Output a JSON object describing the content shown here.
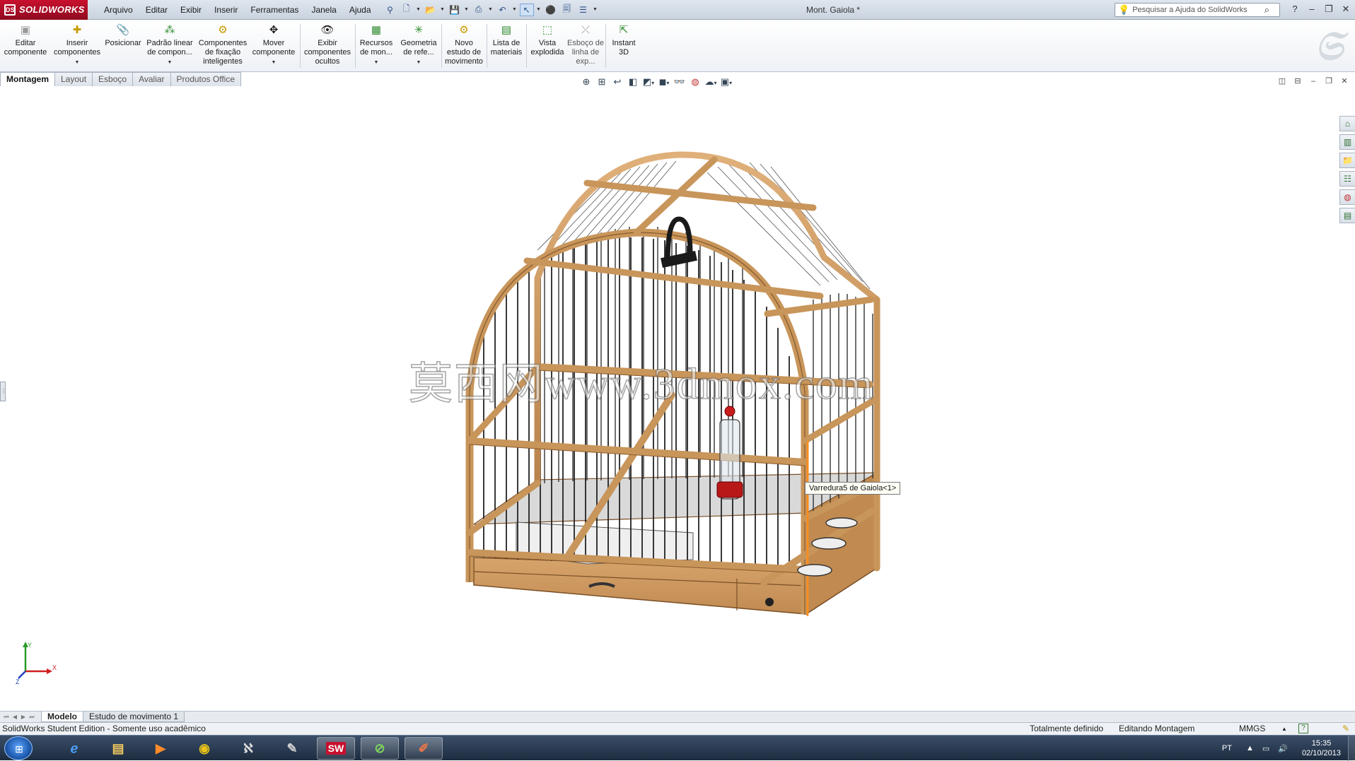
{
  "app": {
    "brand": "SOLIDWORKS",
    "document_title": "Mont. Gaiola *"
  },
  "menu": [
    "Arquivo",
    "Editar",
    "Exibir",
    "Inserir",
    "Ferramentas",
    "Janela",
    "Ajuda"
  ],
  "help_search": {
    "placeholder": "Pesquisar a Ajuda do SolidWorks"
  },
  "command_manager": [
    {
      "label": "Editar componente",
      "icon": "edit-component-icon"
    },
    {
      "label": "Inserir componentes",
      "icon": "insert-components-icon"
    },
    {
      "label": "Posicionar",
      "icon": "mate-icon"
    },
    {
      "label": "Padrão linear de compon...",
      "icon": "linear-pattern-icon"
    },
    {
      "label": "Componentes de fixação inteligentes",
      "icon": "smart-fasteners-icon"
    },
    {
      "label": "Mover componente",
      "icon": "move-component-icon"
    },
    {
      "label": "Exibir componentes ocultos",
      "icon": "show-hidden-icon"
    },
    {
      "label": "Recursos de mon...",
      "icon": "assembly-features-icon"
    },
    {
      "label": "Geometria de refe...",
      "icon": "reference-geometry-icon"
    },
    {
      "label": "Novo estudo de movimento",
      "icon": "motion-study-icon"
    },
    {
      "label": "Lista de materiais",
      "icon": "bom-icon"
    },
    {
      "label": "Vista explodida",
      "icon": "exploded-view-icon"
    },
    {
      "label": "Esboço de linha de exp...",
      "icon": "explode-line-sketch-icon"
    },
    {
      "label": "Instant 3D",
      "icon": "instant3d-icon"
    }
  ],
  "tabs": [
    "Montagem",
    "Layout",
    "Esboço",
    "Avaliar",
    "Produtos Office"
  ],
  "active_tab": "Montagem",
  "viewport": {
    "watermark": "莫西网www.3dmox.com",
    "tooltip": "Varredura5 de Gaiola<1>",
    "triad_labels": {
      "x": "X",
      "y": "Y",
      "z": "Z"
    }
  },
  "bottom_tabs": [
    "Modelo",
    "Estudo de movimento 1"
  ],
  "status": {
    "edition": "SolidWorks Student Edition - Somente uso acadêmico",
    "definition": "Totalmente definido",
    "mode": "Editando Montagem",
    "units": "MMGS"
  },
  "taskbar": {
    "language": "PT",
    "time": "15:35",
    "date": "02/10/2013"
  },
  "colors": {
    "wood": "#c8955a",
    "wood_dark": "#8a5a2b",
    "brand_red": "#c8102e",
    "wire": "#333333"
  }
}
